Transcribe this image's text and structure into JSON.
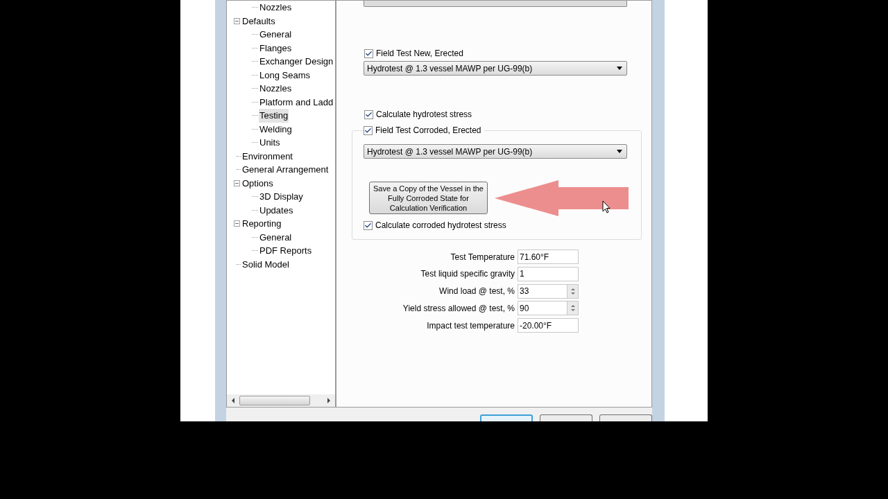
{
  "tree": {
    "partial_children": [
      {
        "label": "Nozzles",
        "selected": false
      }
    ],
    "items": [
      {
        "label": "Defaults",
        "expanded": true,
        "selected": false,
        "children": [
          {
            "label": "General",
            "selected": false
          },
          {
            "label": "Flanges",
            "selected": false
          },
          {
            "label": "Exchanger Design",
            "selected": false
          },
          {
            "label": "Long Seams",
            "selected": false
          },
          {
            "label": "Nozzles",
            "selected": false
          },
          {
            "label": "Platform and Ladd",
            "selected": false
          },
          {
            "label": "Testing",
            "selected": true
          },
          {
            "label": "Welding",
            "selected": false
          },
          {
            "label": "Units",
            "selected": false
          }
        ]
      },
      {
        "label": "Environment",
        "selected": false
      },
      {
        "label": "General Arrangement",
        "selected": false
      },
      {
        "label": "Options",
        "expanded": true,
        "selected": false,
        "children": [
          {
            "label": "3D Display",
            "selected": false
          },
          {
            "label": "Updates",
            "selected": false
          }
        ]
      },
      {
        "label": "Reporting",
        "expanded": true,
        "selected": false,
        "children": [
          {
            "label": "General",
            "selected": false
          },
          {
            "label": "PDF Reports",
            "selected": false
          }
        ]
      },
      {
        "label": "Solid Model",
        "selected": false
      }
    ]
  },
  "field_test_new": {
    "label": "Field Test New, Erected",
    "checked": true,
    "dropdown": "Hydrotest @ 1.3 vessel MAWP per UG-99(b)"
  },
  "calc_hydrotest": {
    "label": "Calculate hydrotest stress",
    "checked": true
  },
  "corroded_group": {
    "legend": {
      "label": "Field Test Corroded, Erected",
      "checked": true
    },
    "dropdown": "Hydrotest @ 1.3 vessel MAWP per UG-99(b)",
    "save_button": "Save a Copy of the Vessel in the Fully Corroded State for Calculation Verification",
    "calc_corroded": {
      "label": "Calculate corroded hydrotest stress",
      "checked": true
    }
  },
  "fields": [
    {
      "label": "Test Temperature",
      "value": "71.60°F",
      "kind": "text"
    },
    {
      "label": "Test liquid specific gravity",
      "value": "1",
      "kind": "text"
    },
    {
      "label": "Wind load @ test, %",
      "value": "33",
      "kind": "spinner"
    },
    {
      "label": "Yield stress allowed @ test, %",
      "value": "90",
      "kind": "spinner"
    },
    {
      "label": "Impact test temperature",
      "value": "-20.00°F",
      "kind": "text"
    }
  ]
}
